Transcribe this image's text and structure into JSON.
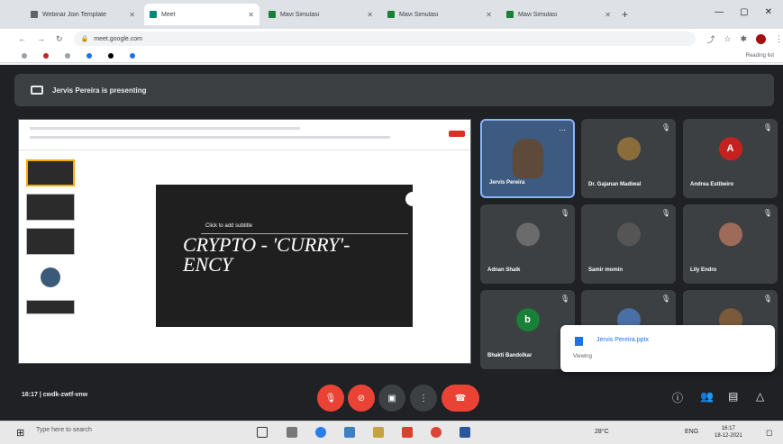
{
  "browser": {
    "tabs": [
      {
        "label": "Webinar Join Template",
        "active": false
      },
      {
        "label": "Meet",
        "active": true
      },
      {
        "label": "Mavi Simulasi",
        "active": false
      },
      {
        "label": "Mavi Simulasi",
        "active": false
      },
      {
        "label": "Mavi Simulasi",
        "active": false
      }
    ],
    "new_tab": "+",
    "address": "meet.google.com",
    "bookmarks_right": "Reading list"
  },
  "meet": {
    "presenting_banner": "Jervis Pereira is presenting",
    "slide": {
      "subtitle": "Click to add subtitle",
      "title": "CRYPTO - 'CURRY'-ENCY"
    },
    "participants": [
      {
        "name": "Jervis Pereira",
        "initial": "",
        "color": "#3d5a80"
      },
      {
        "name": "Dr. Gajanan Madiwal",
        "initial": "",
        "color": "#8a6d3b"
      },
      {
        "name": "Andrea Estibeiro",
        "initial": "A",
        "color": "#c5221f"
      },
      {
        "name": "Adnan Shaik",
        "initial": "",
        "color": "#6b6b6b"
      },
      {
        "name": "Samir momin",
        "initial": "",
        "color": "#555555"
      },
      {
        "name": "Lily Endro",
        "initial": "",
        "color": "#9e6b5a"
      },
      {
        "name": "Bhakti Bandolkar",
        "initial": "b",
        "color": "#188038"
      },
      {
        "name": "",
        "initial": "",
        "color": "#4a6fa5"
      },
      {
        "name": "",
        "initial": "",
        "color": "#7a5a3a"
      }
    ],
    "toast": {
      "title": "Jervis Pereira.pptx",
      "subtitle": "Viewing"
    },
    "meeting_info": "16:17  |  cwdk-zwtf-vnw"
  },
  "taskbar": {
    "search_placeholder": "Type here to search",
    "weather": "28°C",
    "tray": "ENG",
    "time": "16:17",
    "date": "18-12-2021"
  },
  "colors": {
    "meet_bg": "#202124",
    "tile_bg": "#3c4043",
    "red": "#ea4335",
    "accent": "#1a73e8"
  }
}
